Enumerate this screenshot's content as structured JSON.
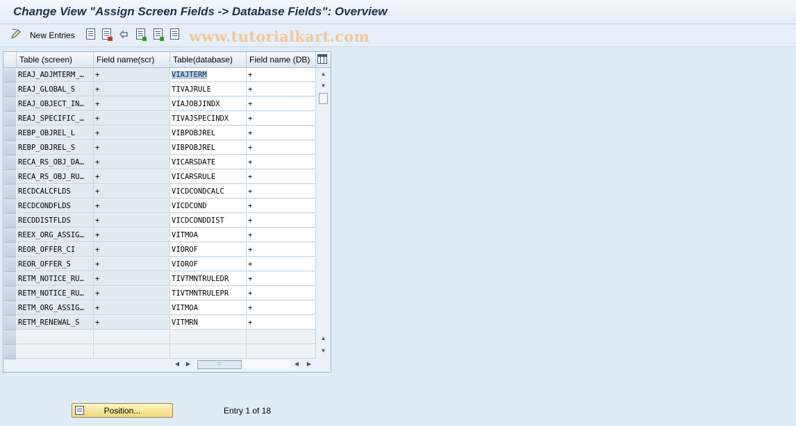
{
  "window": {
    "title": "Change View \"Assign Screen Fields -> Database Fields\": Overview"
  },
  "toolbar": {
    "new_entries_label": "New Entries",
    "icons": [
      "edit-icon",
      "copy-icon",
      "delete-icon",
      "undo-icon",
      "select-all-icon",
      "select-block-icon",
      "deselect-all-icon"
    ]
  },
  "watermark": "www.tutorialkart.com",
  "table": {
    "columns": [
      "Table (screen)",
      "Field name(scr)",
      "Table(database)",
      "Field name (DB)"
    ],
    "rows": [
      [
        "REAJ_ADJMTERM_…",
        "+",
        "VIAJTERM",
        "+"
      ],
      [
        "REAJ_GLOBAL_S",
        "+",
        "TIVAJRULE",
        "+"
      ],
      [
        "REAJ_OBJECT_IN…",
        "+",
        "VIAJOBJINDX",
        "+"
      ],
      [
        "REAJ_SPECIFIC_…",
        "+",
        "TIVAJSPECINDX",
        "+"
      ],
      [
        "REBP_OBJREL_L",
        "+",
        "VIBPOBJREL",
        "+"
      ],
      [
        "REBP_OBJREL_S",
        "+",
        "VIBPOBJREL",
        "+"
      ],
      [
        "RECA_RS_OBJ_DA…",
        "+",
        "VICARSDATE",
        "+"
      ],
      [
        "RECA_RS_OBJ_RU…",
        "+",
        "VICARSRULE",
        "+"
      ],
      [
        "RECDCALCFLDS",
        "+",
        "VICDCONDCALC",
        "+"
      ],
      [
        "RECDCONDFLDS",
        "+",
        "VICDCOND",
        "+"
      ],
      [
        "RECDDISTFLDS",
        "+",
        "VICDCONDDIST",
        "+"
      ],
      [
        "REEX_ORG_ASSIG…",
        "+",
        "VITMOA",
        "+"
      ],
      [
        "REOR_OFFER_CI",
        "+",
        "VIOROF",
        "+"
      ],
      [
        "REOR_OFFER_S",
        "+",
        "VIOROF",
        "+"
      ],
      [
        "RETM_NOTICE_RU…",
        "+",
        "TIVTMNTRULEDR",
        "+"
      ],
      [
        "RETM_NOTICE_RU…",
        "+",
        "TIVTMNTRULEPR",
        "+"
      ],
      [
        "RETM_ORG_ASSIG…",
        "+",
        "VITMOA",
        "+"
      ],
      [
        "RETM_RENEWAL_S",
        "+",
        "VITMRN",
        "+"
      ]
    ]
  },
  "footer": {
    "position_button": "Position...",
    "entry_info": "Entry 1 of 18"
  }
}
